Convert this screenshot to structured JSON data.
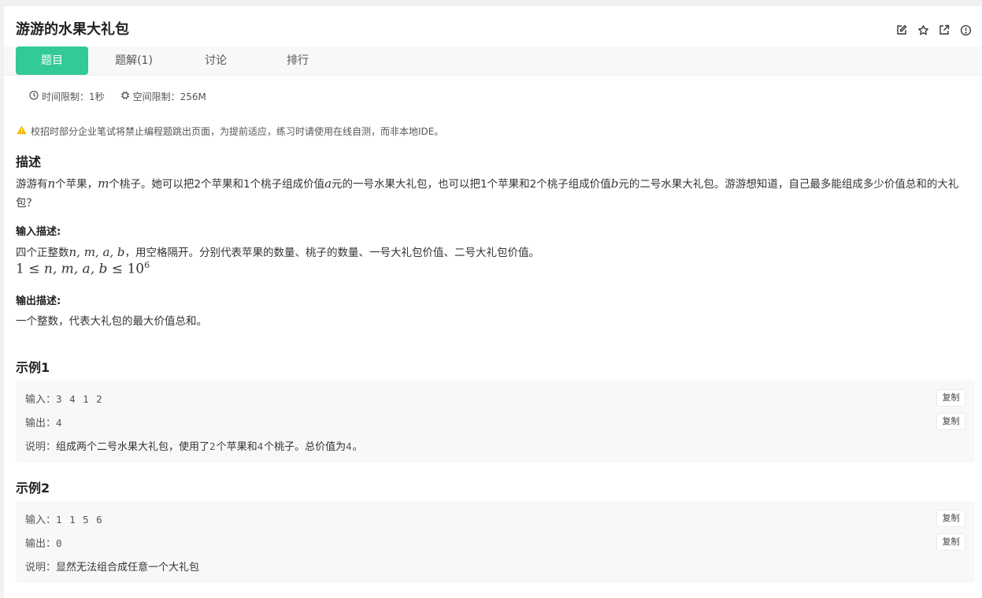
{
  "problem": {
    "title": "游游的水果大礼包",
    "icons": [
      "edit-icon",
      "star-icon",
      "share-icon",
      "info-icon"
    ]
  },
  "tabs": [
    {
      "label": "题目",
      "active": true
    },
    {
      "label": "题解(1)",
      "active": false
    },
    {
      "label": "讨论",
      "active": false
    },
    {
      "label": "排行",
      "active": false
    }
  ],
  "limits": {
    "time": "时间限制：1秒",
    "space": "空间限制：256M"
  },
  "notice": "校招时部分企业笔试将禁止编程题跳出页面，为提前适应，练习时请使用在线自测，而非本地IDE。",
  "description": {
    "heading": "描述",
    "p1_a": "游游有",
    "var_n": "n",
    "p1_b": "个苹果，",
    "var_m": "m",
    "p1_c": "个桃子。她可以把2个苹果和1个桃子组成价值",
    "var_a": "a",
    "p1_d": "元的一号水果大礼包，也可以把1个苹果和2个桃子组成价值",
    "var_b": "b",
    "p1_e": "元的二号水果大礼包。游游想知道，自己最多能组成多少价值总和的大礼包？"
  },
  "input": {
    "heading": "输入描述:",
    "line1_a": "四个正整数",
    "line1_vars": "n, m, a, b",
    "line1_b": "，用空格隔开。分别代表苹果的数量、桃子的数量、一号大礼包价值、二号大礼包价值。",
    "constraint_lhs": "1 ≤ ",
    "constraint_vars": "n, m, a, b",
    "constraint_rhs": " ≤ 10",
    "constraint_exp": "6"
  },
  "output": {
    "heading": "输出描述:",
    "line": "一个整数，代表大礼包的最大价值总和。"
  },
  "examples": [
    {
      "heading": "示例1",
      "input_label": "输入：",
      "input_value": "3 4 1 2",
      "output_label": "输出：",
      "output_value": "4",
      "note_label": "说明：",
      "note_a": "组成两个二号水果大礼包，使用了",
      "note_n1": "2",
      "note_b": "个苹果和",
      "note_n2": "4",
      "note_c": "个桃子。总价值为",
      "note_n3": "4",
      "note_d": "。",
      "copy_label": "复制"
    },
    {
      "heading": "示例2",
      "input_label": "输入：",
      "input_value": "1 1 5 6",
      "output_label": "输出：",
      "output_value": "0",
      "note_label": "说明：",
      "note_a": "显然无法组合成任意一个大礼包",
      "copy_label": "复制"
    }
  ],
  "colors": {
    "accent": "#32ca99",
    "warning": "#f5b800"
  }
}
